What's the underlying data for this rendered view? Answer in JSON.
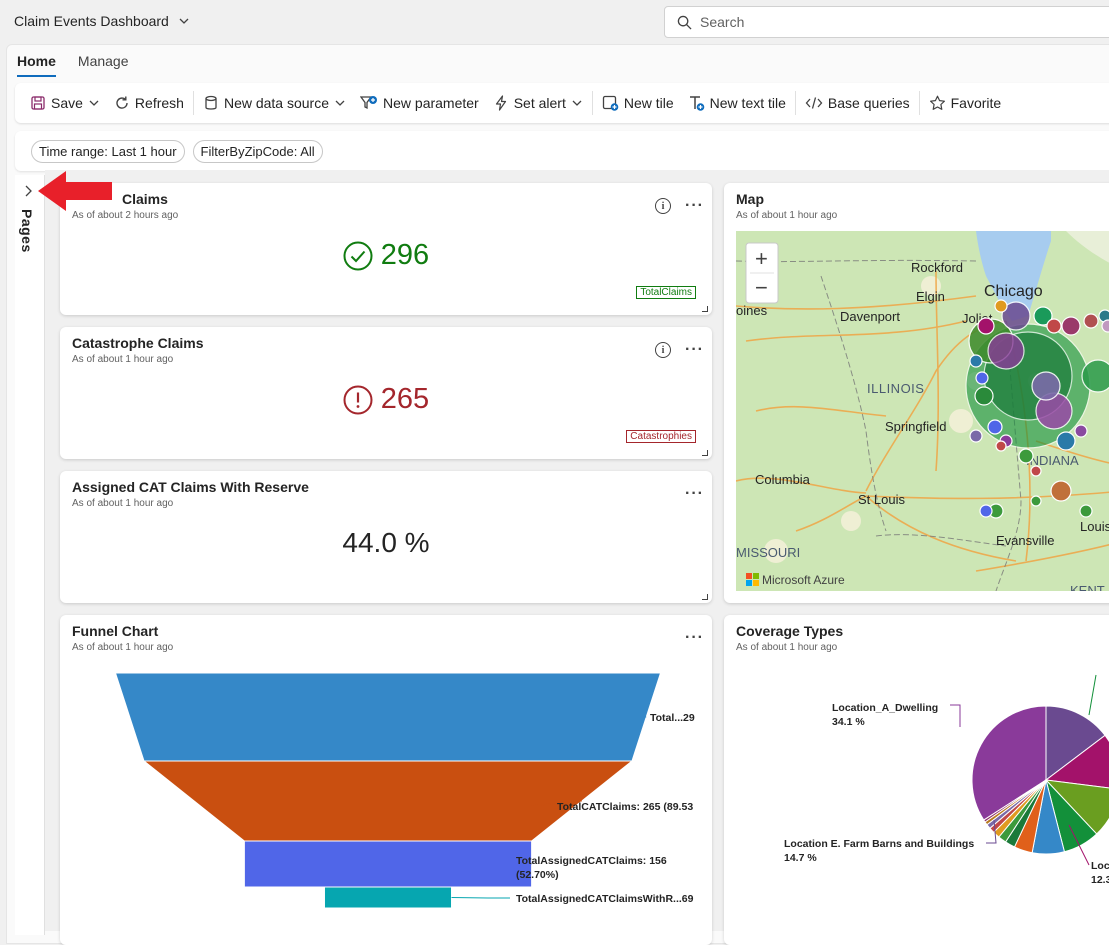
{
  "app": {
    "title": "Claim Events Dashboard"
  },
  "search": {
    "placeholder": "Search"
  },
  "tabs": [
    {
      "label": "Home"
    },
    {
      "label": "Manage"
    }
  ],
  "toolbar": {
    "save": "Save",
    "refresh": "Refresh",
    "new_data_source": "New data source",
    "new_parameter": "New parameter",
    "set_alert": "Set alert",
    "new_tile": "New tile",
    "new_text_tile": "New text tile",
    "base_queries": "Base queries",
    "favorite": "Favorite"
  },
  "filters": [
    {
      "label": "Time range: Last 1 hour"
    },
    {
      "label": "FilterByZipCode: All"
    }
  ],
  "pages_rail": {
    "label": "Pages"
  },
  "colors": {
    "accent": "#0f6cbd",
    "success": "#107c10",
    "danger": "#a4262c",
    "arrow": "#e8202a"
  },
  "tiles": {
    "total_claims": {
      "title": "Claims",
      "subtitle": "As of about 2 hours ago",
      "value": "296",
      "badge": "TotalClaims",
      "icon": "check-circle-icon"
    },
    "cat_claims": {
      "title": "Catastrophe Claims",
      "subtitle": "As of about 1 hour ago",
      "value": "265",
      "badge": "Catastrophies",
      "icon": "alert-circle-icon"
    },
    "assigned": {
      "title": "Assigned CAT Claims With Reserve",
      "subtitle": "As of about 1 hour ago",
      "value": "44.0 %"
    },
    "map": {
      "title": "Map",
      "subtitle": "As of about 1 hour ago",
      "labels": [
        "Rockford",
        "Elgin",
        "Chicago",
        "Davenport",
        "Joliet",
        "ILLINOIS",
        "Springfield",
        "INDIANA",
        "Columbia",
        "St Louis",
        "Louis",
        "Evansville",
        "MISSOURI",
        "KENT",
        "oines"
      ],
      "attribution": "Microsoft Azure",
      "zoom_in": "+",
      "zoom_out": "−"
    },
    "funnel": {
      "title": "Funnel Chart",
      "subtitle": "As of about 1 hour ago",
      "stages": [
        {
          "label": "Total...29",
          "value": 296,
          "color": "#3588c8"
        },
        {
          "label": "TotalCATClaims: 265 (89.53",
          "value": 265,
          "color": "#c94f10"
        },
        {
          "label": "TotalAssignedCATClaims: 156",
          "label2": "(52.70%)",
          "value": 156,
          "color": "#5066e8"
        },
        {
          "label": "TotalAssignedCATClaimsWithR...69",
          "value": 69,
          "color": "#06a6b0"
        }
      ]
    },
    "coverage": {
      "title": "Coverage Types",
      "subtitle": "As of about 1 hour ago",
      "labels": [
        {
          "name": "Location_A_Dwelling",
          "pct": "34.1 %"
        },
        {
          "name": "Location E. Farm Barns and Buildings",
          "pct": "14.7 %"
        },
        {
          "name": "Loc",
          "pct": "12.3"
        }
      ]
    }
  },
  "chart_data": [
    {
      "type": "bar",
      "subtype": "funnel",
      "title": "Funnel Chart",
      "categories": [
        "TotalClaims",
        "TotalCATClaims",
        "TotalAssignedCATClaims",
        "TotalAssignedCATClaimsWithReserve"
      ],
      "values": [
        296,
        265,
        156,
        69
      ],
      "percent_labels": [
        "",
        "89.53",
        "52.70%",
        ""
      ]
    },
    {
      "type": "pie",
      "title": "Coverage Types",
      "slices": [
        {
          "name": "Location_A_Dwelling",
          "value": 34.1,
          "color": "#8a3a9a"
        },
        {
          "name": "Location E. Farm Barns and Buildings",
          "value": 14.7,
          "color": "#6a4a90"
        },
        {
          "name": "Loc",
          "value": 12.3,
          "color": "#a3126a"
        },
        {
          "name": "",
          "value": 11.0,
          "color": "#6a9e20"
        },
        {
          "name": "",
          "value": 8.0,
          "color": "#13903a"
        },
        {
          "name": "",
          "value": 7.0,
          "color": "#3588c8"
        },
        {
          "name": "",
          "value": 4.0,
          "color": "#e0601a"
        },
        {
          "name": "",
          "value": 2.2,
          "color": "#1a7a3a"
        },
        {
          "name": "",
          "value": 1.8,
          "color": "#3c9a3c"
        },
        {
          "name": "",
          "value": 1.5,
          "color": "#e09a20"
        },
        {
          "name": "",
          "value": 1.2,
          "color": "#c04848"
        },
        {
          "name": "",
          "value": 1.0,
          "color": "#7a6aa8"
        },
        {
          "name": "",
          "value": 0.7,
          "color": "#b87a20"
        },
        {
          "name": "",
          "value": 0.5,
          "color": "#8a2a6a"
        }
      ]
    }
  ]
}
